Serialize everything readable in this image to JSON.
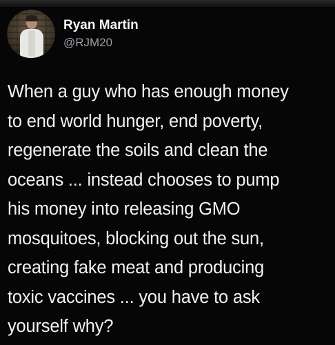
{
  "tweet": {
    "author": {
      "display_name": "Ryan Martin",
      "handle": "@RJM20",
      "avatar_icon": "profile-photo"
    },
    "text_lines": [
      "When a guy who has enough money",
      "to end world hunger, end poverty,",
      "regenerate the soils and clean the",
      "oceans ... instead chooses to pump",
      "his money into releasing GMO",
      "mosquitoes, blocking out the sun,",
      "creating fake meat and producing",
      "toxic vaccines ... you have to ask",
      "yourself why?"
    ]
  },
  "colors": {
    "background": "#060606",
    "text": "#f2f2f2",
    "handle": "#9aa1a8"
  }
}
